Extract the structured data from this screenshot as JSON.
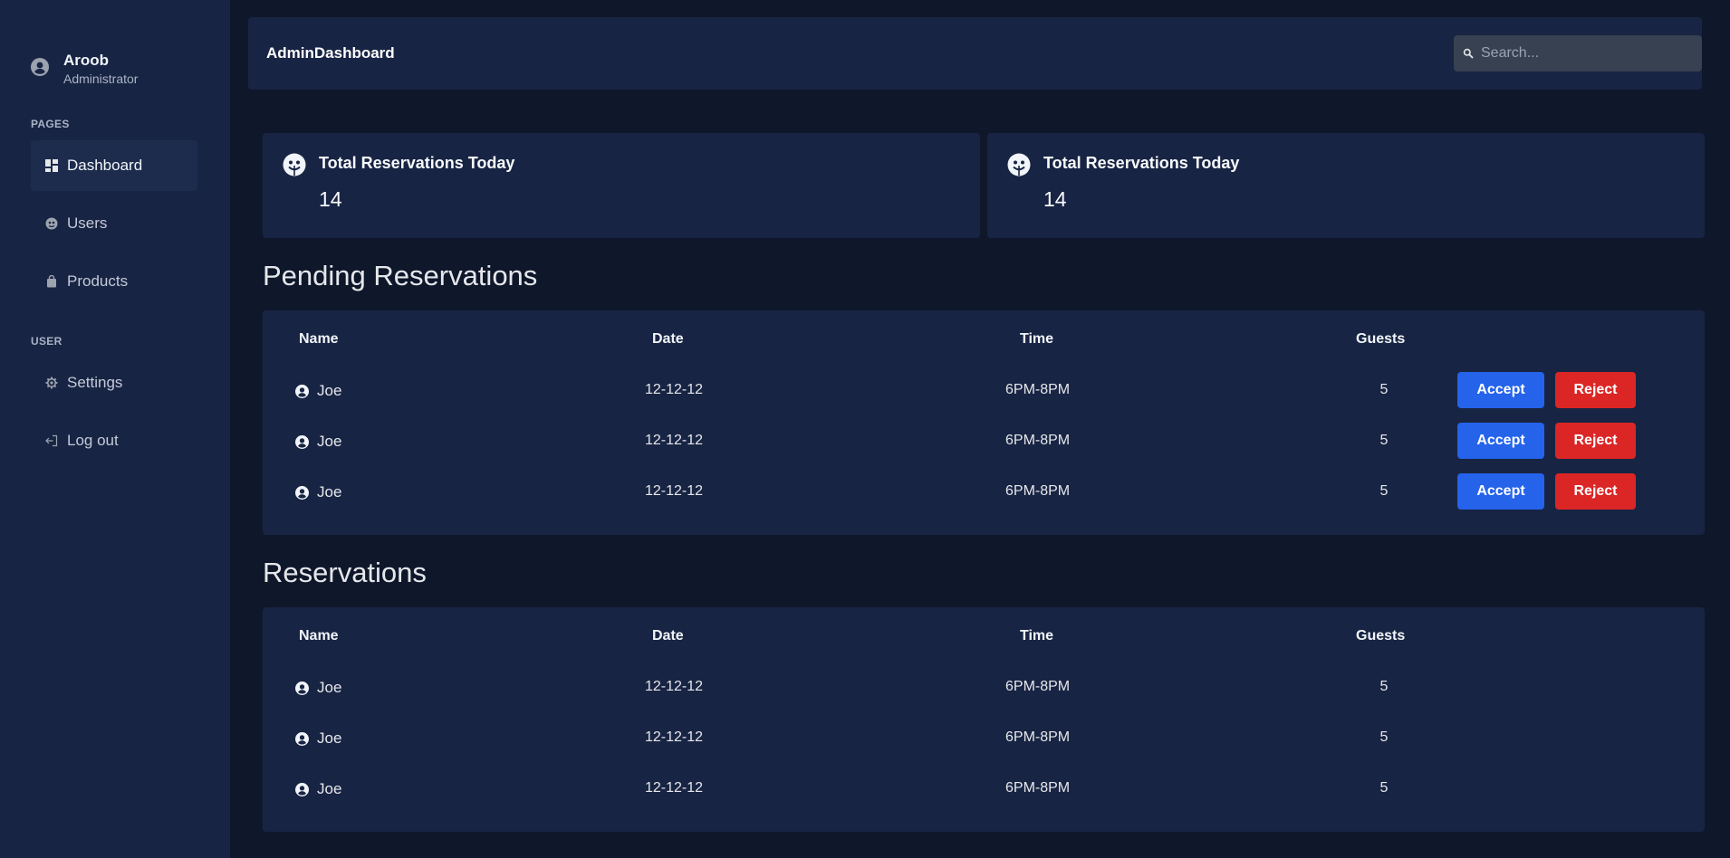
{
  "sidebar": {
    "user": {
      "name": "Aroob",
      "role": "Administrator"
    },
    "pages_label": "PAGES",
    "user_label": "USER",
    "items": [
      {
        "label": "Dashboard",
        "icon": "dashboard-icon",
        "active": true
      },
      {
        "label": "Users",
        "icon": "users-icon"
      },
      {
        "label": "Products",
        "icon": "shopping-bag-icon"
      },
      {
        "label": "Settings",
        "icon": "gear-icon"
      },
      {
        "label": "Log out",
        "icon": "logout-icon"
      }
    ]
  },
  "header": {
    "brand": "AdminDashboard",
    "search_placeholder": "Search..."
  },
  "stats": [
    {
      "title": "Total Reservations Today",
      "value": "14",
      "icon": "face-icon"
    },
    {
      "title": "Total Reservations Today",
      "value": "14",
      "icon": "face-icon"
    }
  ],
  "pending": {
    "title": "Pending Reservations",
    "columns": [
      "Name",
      "Date",
      "Time",
      "Guests"
    ],
    "rows": [
      {
        "name": "Joe",
        "date": "12-12-12",
        "time": "6PM-8PM",
        "guests": "5"
      },
      {
        "name": "Joe",
        "date": "12-12-12",
        "time": "6PM-8PM",
        "guests": "5"
      },
      {
        "name": "Joe",
        "date": "12-12-12",
        "time": "6PM-8PM",
        "guests": "5"
      }
    ],
    "accept_label": "Accept",
    "reject_label": "Reject"
  },
  "reservations": {
    "title": "Reservations",
    "columns": [
      "Name",
      "Date",
      "Time",
      "Guests"
    ],
    "rows": [
      {
        "name": "Joe",
        "date": "12-12-12",
        "time": "6PM-8PM",
        "guests": "5"
      },
      {
        "name": "Joe",
        "date": "12-12-12",
        "time": "6PM-8PM",
        "guests": "5"
      },
      {
        "name": "Joe",
        "date": "12-12-12",
        "time": "6PM-8PM",
        "guests": "5"
      }
    ]
  },
  "colors": {
    "background": "#0f172a",
    "panel": "#182443",
    "accept": "#2563eb",
    "reject": "#dc2626"
  }
}
